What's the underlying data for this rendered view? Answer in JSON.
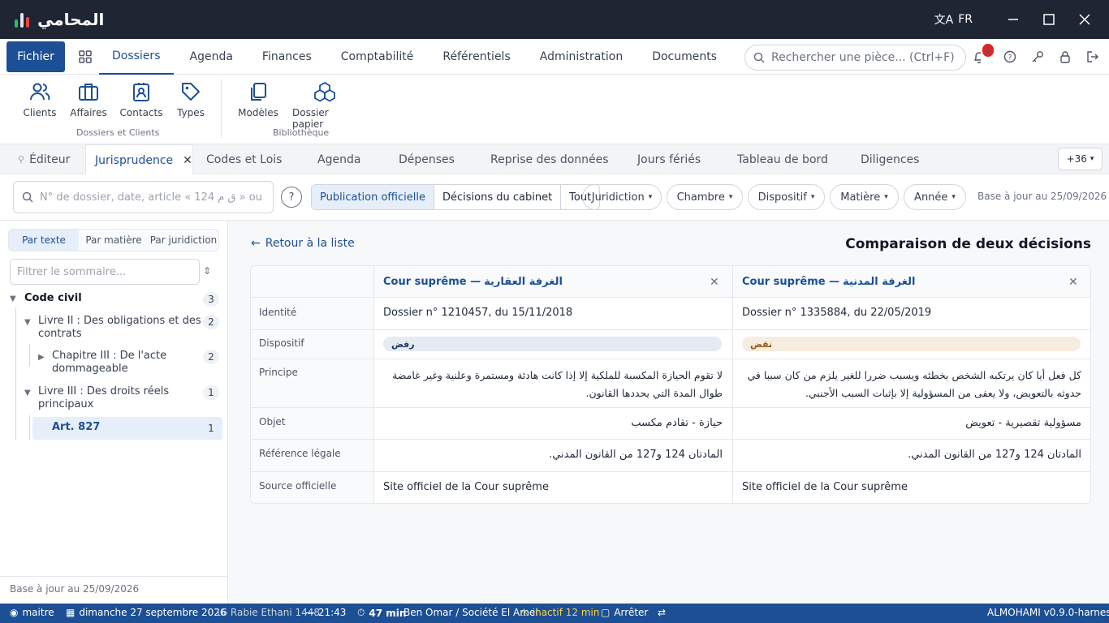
{
  "app": {
    "logo_text": "المحامي",
    "lang": "FR",
    "brand_colors": {
      "primary": "#1d4f94",
      "titlebar": "#1e2533"
    }
  },
  "menu": {
    "fichier": "Fichier",
    "items": [
      "Dossiers",
      "Agenda",
      "Finances",
      "Comptabilité",
      "Référentiels",
      "Administration",
      "Documents"
    ],
    "search_placeholder": "Rechercher une pièce... (Ctrl+F)",
    "notification_count": "1"
  },
  "ribbon": {
    "group1": {
      "label": "Dossiers et Clients",
      "buttons": [
        "Clients",
        "Affaires",
        "Contacts",
        "Types"
      ]
    },
    "group2": {
      "label": "Bibliothèque",
      "buttons": [
        "Modèles",
        "Dossier papier"
      ]
    }
  },
  "tabs": {
    "items": [
      "Éditeur",
      "Jurisprudence",
      "Codes et Lois",
      "Agenda",
      "Dépenses",
      "Reprise des données",
      "Jours fériés",
      "Tableau de bord",
      "Diligences"
    ],
    "more": "+36"
  },
  "filters": {
    "search_placeholder": "N° de dossier, date, article « 124 ق م » ou",
    "help": "?",
    "segments": [
      "Publication officielle",
      "Décisions du cabinet",
      "Tout"
    ],
    "dropdowns": [
      "Juridiction",
      "Chambre",
      "Dispositif",
      "Matière",
      "Année"
    ],
    "base_date": "Base à jour au 25/09/2026"
  },
  "sidebar": {
    "tabs": [
      "Par texte",
      "Par matière",
      "Par juridiction"
    ],
    "filter_placeholder": "Filtrer le sommaire...",
    "tree": {
      "code": {
        "label": "Code civil",
        "count": "3"
      },
      "livre2": {
        "label1": "Livre II : Des obligations et des",
        "label2": "contrats",
        "count": "2"
      },
      "chap3": {
        "label1": "Chapitre III : De l'acte",
        "label2": "dommageable",
        "count": "2"
      },
      "livre3": {
        "label1": "Livre III : Des droits réels",
        "label2": "principaux",
        "count": "1"
      },
      "art": {
        "label": "Art. 827",
        "count": "1"
      }
    },
    "footer": "Base à jour au 25/09/2026"
  },
  "comparison": {
    "back": "Retour à la liste",
    "title": "Comparaison de deux décisions",
    "col1": {
      "header_fr": "Cour suprême —",
      "header_ar": "الغرفة العقارية",
      "identite": "Dossier n° 1210457, du 15/11/2018",
      "dispositif": "رفض",
      "principe1": "لا تقوم الحيازة المكسبة للملكية إلا إذا كانت هادئة ومستمرة وعلنية وغير غامضة",
      "principe2": "طوال المدة التي يحددها القانون.",
      "objet": "حيازة - تقادم مكسب",
      "reference": "المادتان 124 و127 من القانون المدني.",
      "source": "Site officiel de la Cour suprême"
    },
    "col2": {
      "header_fr": "Cour suprême —",
      "header_ar": "الغرفة المدنية",
      "identite": "Dossier n° 1335884, du 22/05/2019",
      "dispositif": "نقض",
      "principe1": "كل فعل أيا كان يرتكبه الشخص بخطئه ويسبب ضررا للغير يلزم من كان سببا في",
      "principe2": "حدوثه بالتعويض، ولا يعفى من المسؤولية إلا بإثبات السبب الأجنبي.",
      "objet": "مسؤولية تقصيرية - تعويض",
      "reference": "المادتان 124 و127 من القانون المدني.",
      "source": "Site officiel de la Cour suprême"
    },
    "labels": [
      "Identité",
      "Dispositif",
      "Principe",
      "Objet",
      "Référence légale",
      "Source officielle"
    ]
  },
  "status": {
    "user": "maitre",
    "date": "dimanche 27 septembre 2026",
    "hijri": "16 Rabie Ethani 1448",
    "time": "— 21:43",
    "timer": "47 min",
    "client": "Ben Omar / Société El Amel",
    "inactive": "inactif 12 min",
    "stop": "Arrêter",
    "version": "ALMOHAMI v0.9.0-harness"
  }
}
